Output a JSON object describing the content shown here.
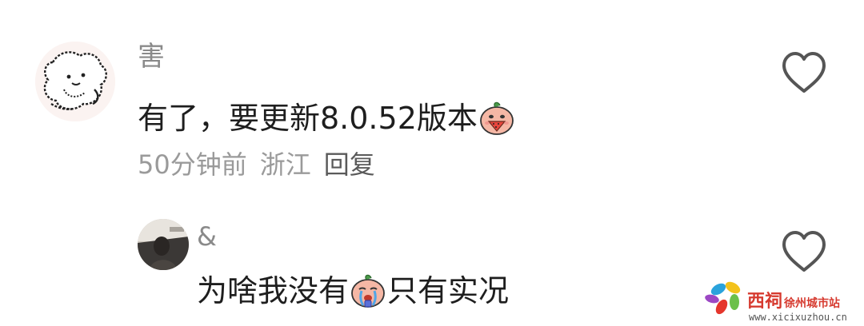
{
  "comments": [
    {
      "username": "害",
      "text_before_emoji": "有了，要更新8.0.52版本",
      "text_after_emoji": "",
      "emoji_icon": "watermelon-peach-emoji",
      "time": "50分钟前",
      "location": "浙江",
      "reply_label": "回复",
      "avatar_icon": "sketch-dog-avatar"
    },
    {
      "username": "&",
      "text_before_emoji": "为啥我没有",
      "text_after_emoji": "只有实况",
      "emoji_icon": "crying-peach-emoji",
      "avatar_icon": "photo-avatar"
    }
  ],
  "watermark": {
    "brand": "西祠",
    "sub": "徐州城市站",
    "url": "www.xicixuzhou.cn"
  }
}
